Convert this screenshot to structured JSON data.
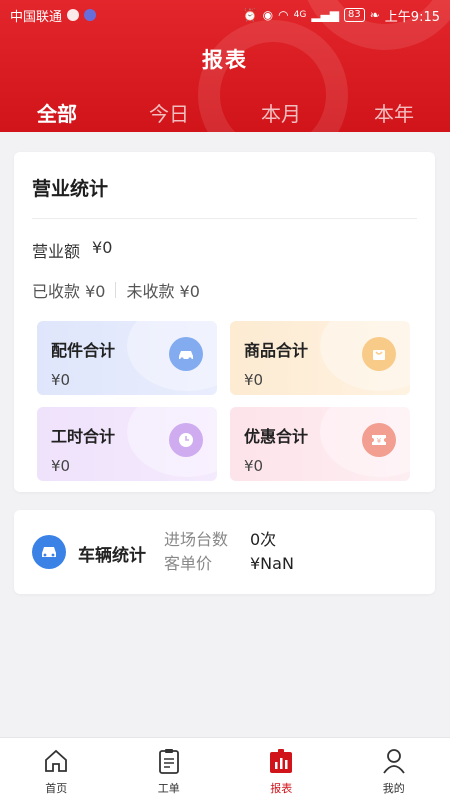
{
  "status_bar": {
    "carrier": "中国联通",
    "signal_label": "4G",
    "battery": "83",
    "time": "上午9:15"
  },
  "header": {
    "title": "报表",
    "tabs": [
      {
        "label": "全部",
        "active": true
      },
      {
        "label": "今日",
        "active": false
      },
      {
        "label": "本月",
        "active": false
      },
      {
        "label": "本年",
        "active": false
      }
    ],
    "colors": {
      "primary": "#d0141a"
    }
  },
  "business": {
    "title": "营业统计",
    "revenue_label": "营业额",
    "revenue_value": "¥0",
    "received": "已收款 ¥0",
    "unreceived": "未收款 ¥0",
    "stats": [
      {
        "label": "配件合计",
        "value": "¥0",
        "icon": "car-parts-icon",
        "color": "#3f7fe8"
      },
      {
        "label": "商品合计",
        "value": "¥0",
        "icon": "shopping-bag-icon",
        "color": "#f4b049"
      },
      {
        "label": "工时合计",
        "value": "¥0",
        "icon": "clock-icon",
        "color": "#b67ee8"
      },
      {
        "label": "优惠合计",
        "value": "¥0",
        "icon": "coupon-icon",
        "color": "#ec6a55"
      }
    ]
  },
  "vehicle": {
    "title": "车辆统计",
    "entries_label": "进场台数",
    "entries_value": "0次",
    "avg_label": "客单价",
    "avg_value": "¥NaN"
  },
  "nav": {
    "items": [
      {
        "label": "首页",
        "icon": "home-icon",
        "active": false
      },
      {
        "label": "工单",
        "icon": "clipboard-icon",
        "active": false
      },
      {
        "label": "报表",
        "icon": "bar-chart-icon",
        "active": true
      },
      {
        "label": "我的",
        "icon": "user-icon",
        "active": false
      }
    ]
  }
}
